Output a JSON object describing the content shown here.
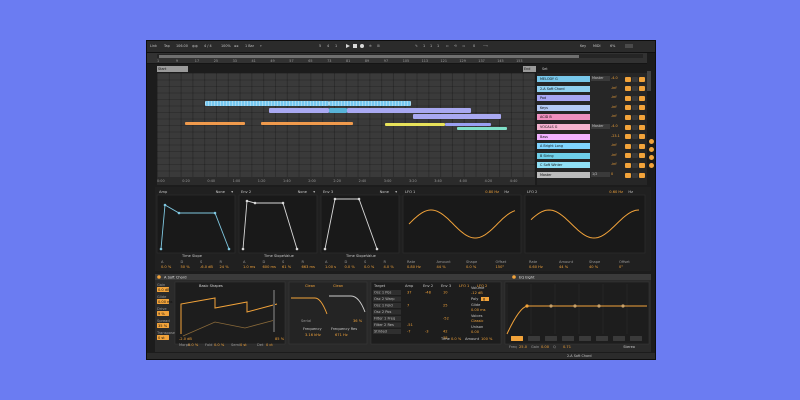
{
  "transport": {
    "link": "Link",
    "tap": "Tap",
    "tempo": "106.00",
    "signature": "4 / 4",
    "zoom": "100%",
    "quantize": "1 Bar",
    "bars": "5",
    "beats": "4",
    "sixteenths": "1",
    "loop_start": "1",
    "loop_len": "0",
    "key": "Key",
    "midi": "MIDI",
    "cpu": "6%",
    "pos_a": "1",
    "pos_b": "1",
    "pos_c": "1"
  },
  "ruler": {
    "bar_numbers": [
      "1",
      "9",
      "17",
      "25",
      "33",
      "41",
      "49",
      "57",
      "65",
      "73",
      "81",
      "89",
      "97",
      "105",
      "113",
      "121",
      "129",
      "137",
      "145",
      "153"
    ],
    "start_label": "Start",
    "end_label": "End",
    "set_label": "Set"
  },
  "time_labels": [
    "0:00",
    "0:20",
    "0:40",
    "1:00",
    "1:20",
    "1:40",
    "2:00",
    "2:20",
    "2:40",
    "3:00",
    "3:20",
    "3:40",
    "4:00",
    "4:20",
    "4:40"
  ],
  "tracks": [
    {
      "name": "MELODY G",
      "color": "#77c7ea",
      "routing": "Master",
      "vol": "-4.0"
    },
    {
      "name": "2-A Soft Chord",
      "color": "#8fd0f0",
      "routing": "",
      "vol": "-inf"
    },
    {
      "name": "Pad",
      "color": "#a6a6f5",
      "routing": "",
      "vol": "-inf"
    },
    {
      "name": "Keys",
      "color": "#b3c9f5",
      "routing": "",
      "vol": "-inf"
    },
    {
      "name": "ACID B",
      "color": "#f08fbf",
      "routing": "",
      "vol": "-inf"
    },
    {
      "name": "VOCALS G",
      "color": "#f5b2cf",
      "routing": "Master",
      "vol": "-4.0"
    },
    {
      "name": "Bass",
      "color": "#f2b0ff",
      "routing": "",
      "vol": "-23.1"
    },
    {
      "name": "A Bright Long",
      "color": "#7fd4ff",
      "routing": "",
      "vol": "-inf"
    },
    {
      "name": "B String",
      "color": "#6ecfe8",
      "routing": "",
      "vol": "-inf"
    },
    {
      "name": "C Soft Winter",
      "color": "#8fdff5",
      "routing": "",
      "vol": "-inf"
    },
    {
      "name": "Master",
      "color": "#bcbcbc",
      "routing": "1/2",
      "vol": "0"
    }
  ],
  "envelopes": {
    "amp": {
      "title": "Amp",
      "mode": "None",
      "time_label": "Time",
      "slope_label": "Slope",
      "params": [
        {
          "k": "A",
          "v": "0.0 %"
        },
        {
          "k": "D",
          "v": "50 %"
        },
        {
          "k": "S",
          "v": "-6.0 dB"
        },
        {
          "k": "R",
          "v": "24 %"
        }
      ]
    },
    "env2": {
      "title": "Env 2",
      "mode": "None",
      "time_label": "Time",
      "slope_label": "Slope",
      "value_label": "Value",
      "params": [
        {
          "k": "A",
          "v": "1.0 ms"
        },
        {
          "k": "D",
          "v": "600 ms"
        },
        {
          "k": "S",
          "v": "61 %"
        },
        {
          "k": "R",
          "v": "663 ms"
        }
      ]
    },
    "env3": {
      "title": "Env 3",
      "mode": "None",
      "time_label": "Time",
      "slope_label": "Slope",
      "value_label": "Value",
      "params": [
        {
          "k": "A",
          "v": "1.00 s"
        },
        {
          "k": "D",
          "v": "0.0 %"
        },
        {
          "k": "S",
          "v": "0.0 %"
        },
        {
          "k": "R",
          "v": "4.0 %"
        }
      ]
    },
    "lfo1": {
      "title": "LFO 1",
      "rate_display": "0.80 Hz",
      "unit": "Hz",
      "params": [
        {
          "k": "Rate",
          "v": "0.80 Hz"
        },
        {
          "k": "Amount",
          "v": "44 %"
        },
        {
          "k": "Shape",
          "v": "0.0 %"
        },
        {
          "k": "Offset",
          "v": "150°"
        }
      ]
    },
    "lfo2": {
      "title": "LFO 2",
      "rate_display": "0.60 Hz",
      "unit": "Hz",
      "params": [
        {
          "k": "Rate",
          "v": "0.60 Hz"
        },
        {
          "k": "Amount",
          "v": "44 %"
        },
        {
          "k": "Shape",
          "v": "40 %"
        },
        {
          "k": "Offset",
          "v": "0°"
        }
      ]
    }
  },
  "device": {
    "title": "A Soft Chord",
    "knob_labels": [
      "Gain",
      "Glide",
      "Drive",
      "Spread",
      "Transpose"
    ],
    "knob_values": [
      "0.0 dB",
      "0.00 ms",
      "9 %",
      "35 %",
      "0 st"
    ],
    "osc_title": "Basic Shapes",
    "osc_value": "-2.0 dB",
    "osc_params": [
      {
        "k": "Morph",
        "v": "0.0 %"
      },
      {
        "k": "Fold",
        "v": "0.0 %"
      },
      {
        "k": "Semi",
        "v": "0 st"
      },
      {
        "k": "Det",
        "v": "0 ct"
      }
    ],
    "pct": "85 %",
    "filter1": "Clean",
    "filter2": "Clean",
    "filter_subtitle": "Serial",
    "freq_label": "Frequency",
    "freq_value": "3.16 kHz",
    "freq2_label": "Frequency Res",
    "freq2_value": "671 Hz",
    "res_value": "36 %",
    "matrix_title": "Target",
    "matrix_cols": [
      "Amp",
      "Env 2",
      "Env 3",
      "LFO 1",
      "LFO 2"
    ],
    "matrix_rows": [
      "Osc 1 Pos",
      "Osc 2 Warp",
      "Osc 1 Fold",
      "Osc 2 Pos",
      "Filter 1 Freq",
      "Filter 2 Res",
      "Strided"
    ],
    "matrix_vals": [
      "37",
      "-48",
      "10",
      "",
      "",
      "",
      "7",
      "",
      "25",
      "",
      "",
      "",
      "",
      "",
      "-52",
      "-51",
      "",
      "",
      "-7",
      "-3",
      "42",
      "",
      "",
      "38"
    ],
    "time_label": "Time",
    "time_value": "0.0 %",
    "amount_label": "Amount",
    "amount_value": "100 %",
    "volume_label": "Volume",
    "volume_value": "-12 dB",
    "poly_label": "Poly",
    "poly_value": "8",
    "glide_label": "Glide",
    "glide_value": "0.00 ms",
    "voices_label": "Voices",
    "voices_value": "Classic",
    "unison_label": "Unison",
    "amount2_value": "0.00",
    "eq_title": "EQ Eight",
    "eq_labels": [
      "Freq",
      "Gain",
      "Q"
    ],
    "eq_values": [
      "25.0",
      "0.00",
      "0.71"
    ],
    "eq_mode": "Stereo",
    "bottom_track": "2-A Soft Chord"
  },
  "colors": {
    "accent": "#f2a33a",
    "clip_blue": "#78c8ef",
    "clip_lavender": "#a9a9f2",
    "clip_orange": "#f09a4c",
    "clip_yellow": "#e8e25a",
    "clip_green": "#7fe0c8",
    "background": "#6b7cf2"
  }
}
